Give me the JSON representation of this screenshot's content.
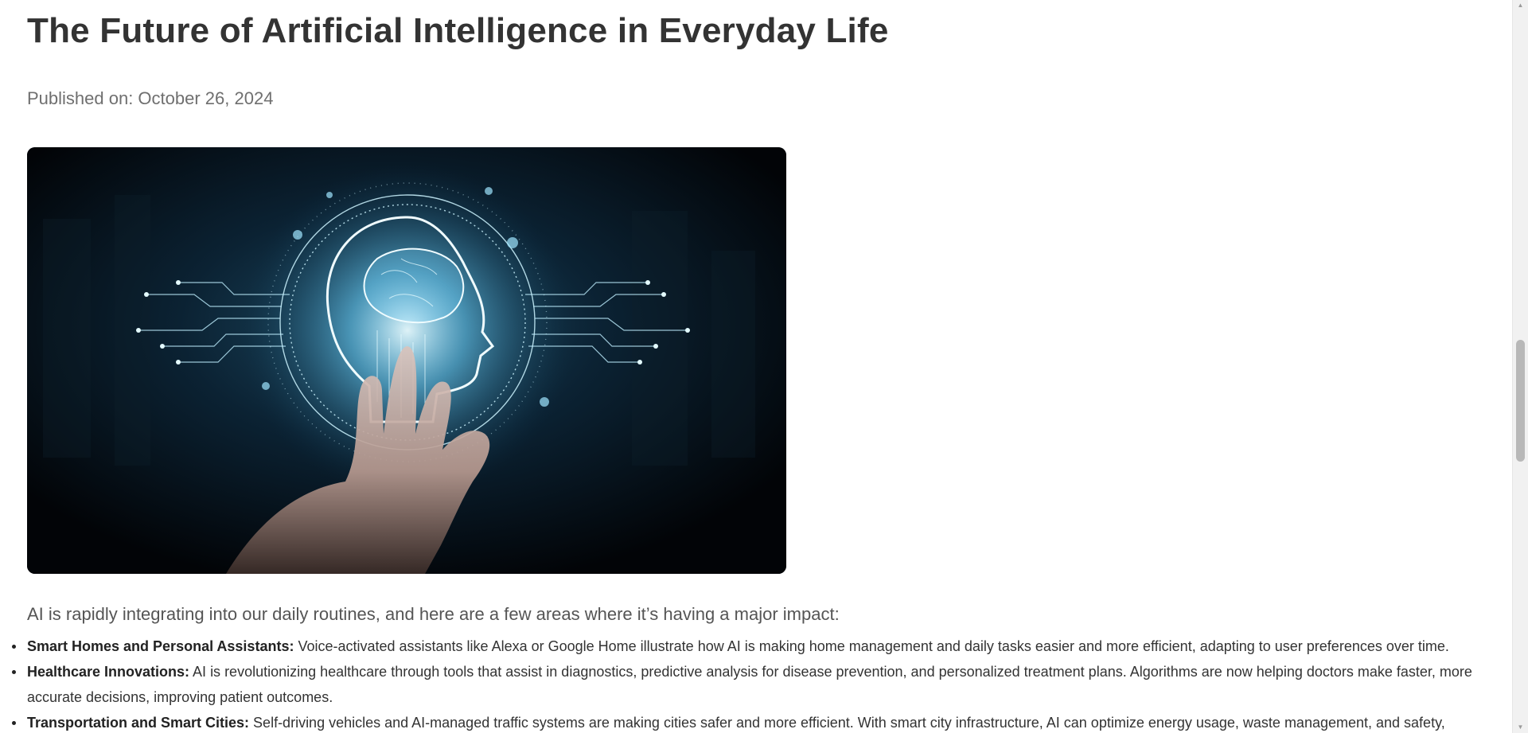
{
  "article": {
    "title": "The Future of Artificial Intelligence in Everyday Life",
    "published": "Published on: October 26, 2024",
    "intro": "AI is rapidly integrating into our daily routines, and here are a few areas where it’s having a major impact:",
    "items": [
      {
        "heading": "Smart Homes and Personal Assistants:",
        "text": " Voice-activated assistants like Alexa or Google Home illustrate how AI is making home management and daily tasks easier and more efficient, adapting to user preferences over time."
      },
      {
        "heading": "Healthcare Innovations:",
        "text": " AI is revolutionizing healthcare through tools that assist in diagnostics, predictive analysis for disease prevention, and personalized treatment plans. Algorithms are now helping doctors make faster, more accurate decisions, improving patient outcomes."
      },
      {
        "heading": "Transportation and Smart Cities:",
        "text": " Self-driving vehicles and AI-managed traffic systems are making cities safer and more efficient. With smart city infrastructure, AI can optimize energy usage, waste management, and safety,"
      }
    ]
  },
  "scrollbar": {
    "up_icon": "triangle-up-icon",
    "down_icon": "triangle-down-icon",
    "position": 0.55
  },
  "colors": {
    "text": "#333333",
    "muted": "#6f6f6f",
    "hero_background": "#03060a",
    "hero_glow": "#7fdcff"
  }
}
